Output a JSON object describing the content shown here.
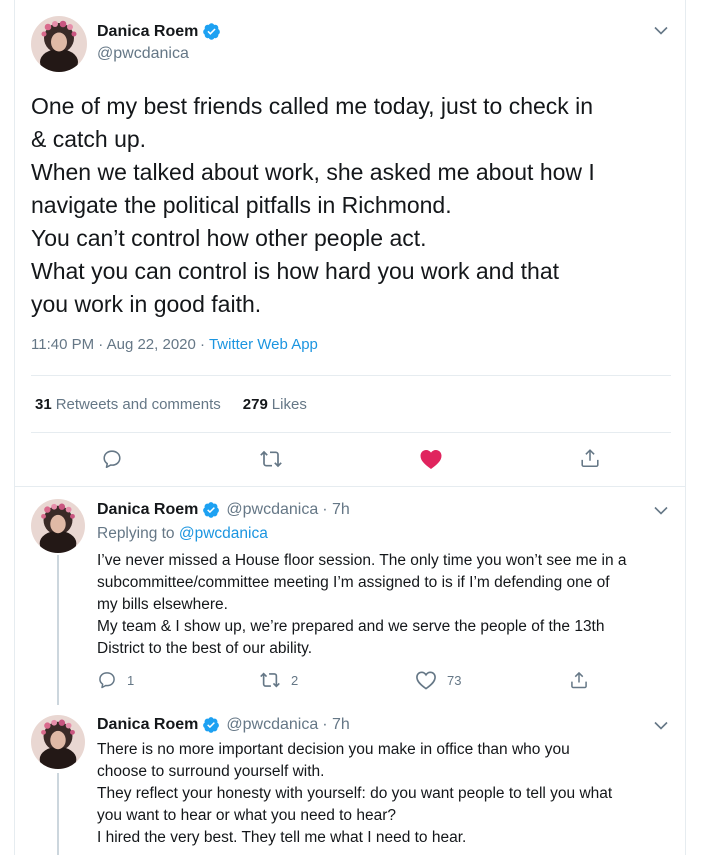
{
  "main_tweet": {
    "author": {
      "name": "Danica Roem",
      "handle": "@pwcdanica",
      "verified": true
    },
    "text_lines": [
      "One of my best friends called me today, just to check in",
      "& catch up.",
      "When we talked about work, she asked me about how I",
      "navigate the political pitfalls in Richmond.",
      "You can’t control how other people act.",
      "What you can control is how hard you work and that",
      "you work in good faith."
    ],
    "time": "11:40 PM",
    "date": "Aug 22, 2020",
    "source": "Twitter Web App",
    "stats": {
      "retweets_count": "31",
      "retweets_label": "Retweets and comments",
      "likes_count": "279",
      "likes_label": "Likes"
    },
    "liked": true
  },
  "replies": [
    {
      "name": "Danica Roem",
      "handle": "@pwcdanica",
      "time": "· 7h",
      "replying_prefix": "Replying to ",
      "replying_to": "@pwcdanica",
      "text_lines": [
        "I’ve never missed a House floor session. The only time you won’t see me in a",
        "subcommittee/committee meeting I’m assigned to is if I’m defending one of",
        "my bills elsewhere.",
        "My team & I show up, we’re prepared and we serve the people of the 13th",
        "District to the best of our ability."
      ],
      "reply_count": "1",
      "retweet_count": "2",
      "like_count": "73"
    },
    {
      "name": "Danica Roem",
      "handle": "@pwcdanica",
      "time": "· 7h",
      "text_lines": [
        "There is no more important decision you make in office than who you",
        "choose to surround yourself with.",
        "They reflect your honesty with yourself: do you want people to tell you what",
        "you want to hear or what you need to hear?",
        "I hired the very best. They tell me what I need to hear."
      ]
    }
  ],
  "colors": {
    "text": "#14171a",
    "secondary": "#657786",
    "link": "#1b95e0",
    "verified": "#1da1f2",
    "like_active": "#e0245e",
    "border": "#e6ecf0"
  }
}
